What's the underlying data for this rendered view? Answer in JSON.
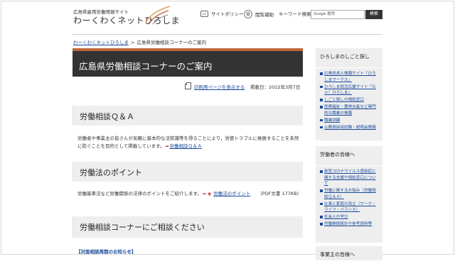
{
  "header": {
    "subtitle": "広島県雇用労働情報サイト",
    "title": "わーくわくネットひろしま",
    "site_policy": "サイトポリシー",
    "reading_assist": "閲覧補助",
    "keyword_label": "キーワード検索",
    "search_placeholder": "Google 提供",
    "search_button": "検索"
  },
  "breadcrumb": {
    "home": "わーくわくネットひろしま",
    "separator": ">",
    "current": "広島県労働相談コーナーのご案内"
  },
  "main": {
    "page_title": "広島県労働相談コーナーのご案内",
    "print_link": "印刷用ページを表示する",
    "published": "掲載日：2022年3月7日",
    "sections": [
      {
        "heading": "労働相談Ｑ＆Ａ",
        "text": "労働者や事業主の皆さんが気軽に基本的な法知識等を得ることにより，労使トラブルに発展することを未然に防ぐことを目的として掲載しています。",
        "link": "労働相談Ｑ＆Ａ"
      },
      {
        "heading": "労働法のポイント",
        "text": "労働基準法など労働関係の法律のポイントをご紹介します。",
        "link": "労働法のポイント",
        "file_info": "（PDF文書 177KB)"
      },
      {
        "heading": "労働相談コーナーにご相談ください"
      }
    ],
    "notice": "【対面相談再開のお知らせ】"
  },
  "sidebar": {
    "boxes": [
      {
        "heading": "ひろしまのしごと探し",
        "items": [
          "広島県求人情報サイト「ひろしまワークス」",
          "ひろしま就活応援サイト「Ｇｏ！ひろしま」",
          "しごと探しの相談窓口",
          "医療福祉・農林水産など専門的な職業の情報",
          "職業訓練",
          "公務員採用試験・説明会情報"
        ]
      },
      {
        "heading": "労働者の皆様へ",
        "items": [
          "新型コロナウイルス感染症に関する支援や相談窓口について",
          "労働に関するお悩み（労働相談Ｑ＆Ａ）",
          "仕事と家庭の両立（ワーク・ライフ・バランス）",
          "社会人の学び",
          "労働関係統計や参考資料等"
        ]
      },
      {
        "heading": "事業主の皆様へ",
        "items": []
      }
    ]
  },
  "colors": {
    "accent": "#c0673a",
    "title_bg": "#333333",
    "link": "#1a4b9b",
    "section_bg": "#eeeeee"
  }
}
